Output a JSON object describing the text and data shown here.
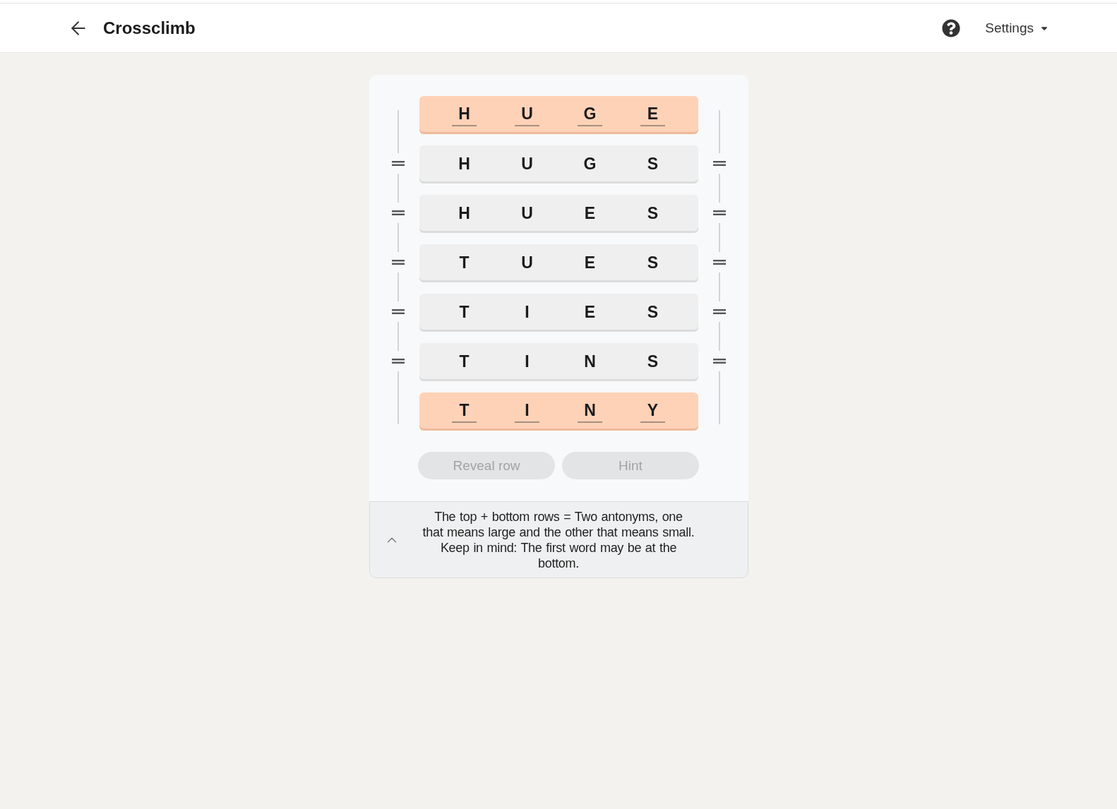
{
  "header": {
    "title": "Crossclimb",
    "settings_label": "Settings"
  },
  "rows": [
    {
      "kind": "locked",
      "letters": [
        "H",
        "U",
        "G",
        "E"
      ]
    },
    {
      "kind": "movable",
      "letters": [
        "H",
        "U",
        "G",
        "S"
      ]
    },
    {
      "kind": "movable",
      "letters": [
        "H",
        "U",
        "E",
        "S"
      ]
    },
    {
      "kind": "movable",
      "letters": [
        "T",
        "U",
        "E",
        "S"
      ]
    },
    {
      "kind": "movable",
      "letters": [
        "T",
        "I",
        "E",
        "S"
      ]
    },
    {
      "kind": "movable",
      "letters": [
        "T",
        "I",
        "N",
        "S"
      ]
    },
    {
      "kind": "locked",
      "letters": [
        "T",
        "I",
        "N",
        "Y"
      ]
    }
  ],
  "buttons": [
    {
      "label": "Reveal row",
      "disabled": true
    },
    {
      "label": "Hint",
      "disabled": true
    }
  ],
  "clue": {
    "text": "The top + bottom rows = Two antonyms, one that means large and the other that means small. Keep in mind: The first word may be at the bottom."
  }
}
